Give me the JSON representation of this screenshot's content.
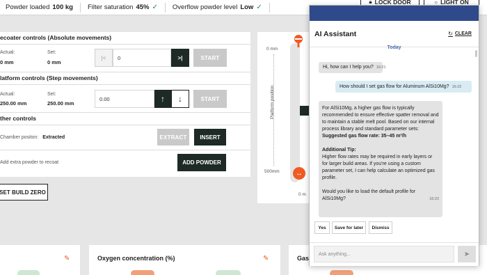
{
  "status_bar": {
    "powder_label": "Powder loaded",
    "powder_value": "100 kg",
    "filter_label": "Filter saturation",
    "filter_value": "45%",
    "overflow_label": "Overflow powder level",
    "overflow_value": "Low",
    "check_icon": "check-icon",
    "check_color": "#1f8a4c",
    "lock_door_label": "LOCK DOOR",
    "light_on_label": "LIGHT ON"
  },
  "recoater": {
    "title": "ecoater controls (Absolute movements)",
    "actual_label": "Actual:",
    "actual_value": "0 mm",
    "set_label": "Set:",
    "set_value": "0 mm",
    "input_value": "0",
    "start_label": "START"
  },
  "platform": {
    "title": "latform controls (Step movements)",
    "actual_label": "Actual:",
    "actual_value": "250.00 mm",
    "set_label": "Set:",
    "set_value": "250.00 mm",
    "input_value": "0.00",
    "start_label": "START"
  },
  "other": {
    "title": "ther controls",
    "chamber_label": "Chamber positon:",
    "chamber_value": "Extracted",
    "extract_label": "EXTRACT",
    "insert_label": "INSERT",
    "powder_label": "Add extra powder to recoat",
    "add_powder_label": "ADD POWDER",
    "build_zero_label": "SET BUILD ZERO"
  },
  "platform_visual": {
    "top_label": "0 mm",
    "bottom_label": "500mm",
    "axis_label": "Platform position",
    "right_label": "0 m"
  },
  "cards": [
    {
      "title": ""
    },
    {
      "title": "Oxygen concentration (%)"
    },
    {
      "title": "Gas"
    }
  ],
  "assistant": {
    "title": "AI Assistant",
    "clear_label": "CLEAR",
    "day_label": "Today",
    "messages": [
      {
        "from": "bot",
        "text": "Hi, how can I help you?",
        "time": "16:21"
      },
      {
        "from": "user",
        "text": "How should I set gas flow for Aluminum AlSi10Mg?",
        "time": "16:22"
      },
      {
        "from": "bot",
        "intro": "For AlSi10Mg, a higher gas flow is typically recommended to ensure effective spatter removal and to maintain a stable melt pool. Based on our internal process library and standard parameter sets:",
        "suggest": "Suggested gas flow rate: 35–45 m³/h",
        "tip_title": "Additional Tip:",
        "tip": "Higher flow rates may be required in early layers or for larger build areas. If you're using a custom parameter set, I can help calculate an optimized gas profile.",
        "question": "Would you like to load the default profile for AlSi10Mg?",
        "time": "16:22"
      }
    ],
    "quick_replies": [
      "Yes",
      "Save for later",
      "Dismiss"
    ],
    "input_placeholder": "Ask anything...",
    "accent": "#2f4a8a"
  },
  "colors": {
    "dark_button": "#1d2a26",
    "accent_orange": "#f05a23"
  }
}
